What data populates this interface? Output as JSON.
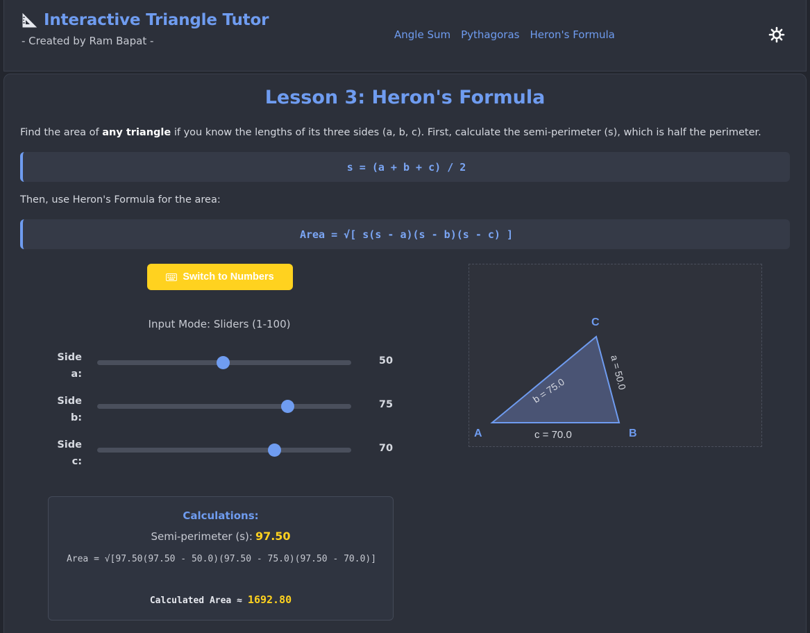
{
  "header": {
    "title": "Interactive Triangle Tutor",
    "subtitle": "- Created by Ram Bapat -",
    "nav": [
      "Angle Sum",
      "Pythagoras",
      "Heron's Formula"
    ],
    "theme_icon": "sun-icon"
  },
  "lesson": {
    "title": "Lesson 3: Heron's Formula",
    "intro_before": "Find the area of ",
    "intro_bold": "any triangle",
    "intro_after": " if you know the lengths of its three sides (a, b, c). First, calculate the semi-perimeter (s), which is half the perimeter.",
    "formula_s": "s = (a + b + c) / 2",
    "then_text": "Then, use Heron's Formula for the area:",
    "formula_area": "Area = √[ s(s - a)(s - b)(s - c) ]"
  },
  "controls": {
    "switch_label": "Switch to Numbers",
    "switch_icon": "keyboard-icon",
    "mode_label": "Input Mode: Sliders (1-100)",
    "min": 1,
    "max": 100,
    "sliders": [
      {
        "label": "Side a:",
        "value": 50
      },
      {
        "label": "Side b:",
        "value": 75
      },
      {
        "label": "Side c:",
        "value": 70
      }
    ]
  },
  "calculations": {
    "title": "Calculations:",
    "semi_label": "Semi-perimeter (s):",
    "semi_value": "97.50",
    "area_expression": "Area = √[97.50(97.50 - 50.0)(97.50 - 75.0)(97.50 - 70.0)]",
    "area_label": "Calculated Area ≈",
    "area_value": "1692.80"
  },
  "triangle": {
    "vertices": [
      "A",
      "B",
      "C"
    ],
    "side_a_label": "a = 50.0",
    "side_b_label": "b = 75.0",
    "side_c_label": "c = 70.0",
    "fill_color": "#4a5474",
    "stroke_color": "#6f9cf0"
  },
  "colors": {
    "accent": "#6f9cf0",
    "highlight": "#ffd21f",
    "background": "#23262e",
    "panel": "#2c303a"
  }
}
